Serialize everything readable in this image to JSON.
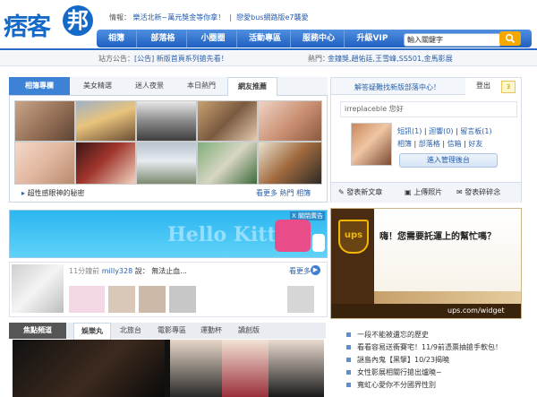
{
  "header": {
    "logo_main": "痞客",
    "logo_circle": "邦",
    "ad_label": "情報：",
    "ad_link1": "樂活北新~萬元獎金等你拿！",
    "ad_link2": "戀愛bus網路版e7襲愛",
    "nav": [
      "相簿",
      "部落格",
      "小圈圈",
      "活動專區",
      "服務中心",
      "升級VIP"
    ],
    "search_placeholder": "輸入關鍵字",
    "search_icon": "magnifier-icon"
  },
  "sub_bar": {
    "announce_label": "站方公告：",
    "announce_text": "[公告] 新版首頁系列搶先看！",
    "hot_label": "熱門：",
    "hot_items": "金鐘獎,趙佑廷,王雪峰,SS501,金馬影展"
  },
  "photo_panel": {
    "tabs": [
      "相簿專欄",
      "美女精選",
      "迷人夜景",
      "本日熱門",
      "網友推薦"
    ],
    "caption_left": "超性感眼神的秘密",
    "caption_right": "看更多 熱門 相簿"
  },
  "banner": {
    "title": "Hello Kitty",
    "close": "X 關閉廣告"
  },
  "moment": {
    "time": "11分鐘前",
    "user": "milly328",
    "says": "說：",
    "text": "無法止血...",
    "more": "看更多"
  },
  "featured": {
    "tabs": [
      "焦點頻道",
      "娛樂丸",
      "北旅台",
      "電影專區",
      "運動杯",
      "讀創版"
    ]
  },
  "login_panel": {
    "top_link": "解答疑難找新版部落中心！",
    "logout": "登出",
    "count": "3",
    "welcome": "irreplaceble 您好",
    "links_row1": [
      "短訊(1)",
      "迴響(0)",
      "留言板(1)"
    ],
    "links_row2": [
      "相簿",
      "部落格",
      "信箱",
      "好友"
    ],
    "manage": "進入管理後台",
    "actions": [
      "發表新文章",
      "上傳照片",
      "發表碎碎念"
    ]
  },
  "ad_ups": {
    "text": "嗨！您需要託運上的幫忙嗎？",
    "url": "ups.com/widget",
    "brand": "ups"
  },
  "news": [
    "一段不能被遺忘的歷史",
    "看看容易送衝賽宅！11/9前憑票抽搶手軟包！",
    "謎島內鬼【黑擘】10/23揭曉",
    "女性影展相關行搶出爐曉~",
    "寬虹心愛你不分國界性別"
  ],
  "colors": {
    "brand_blue": "#1569c7",
    "nav_blue": "#2a6bc6",
    "search_orange": "#f5a800",
    "ups_brown": "#5a3a1a"
  }
}
